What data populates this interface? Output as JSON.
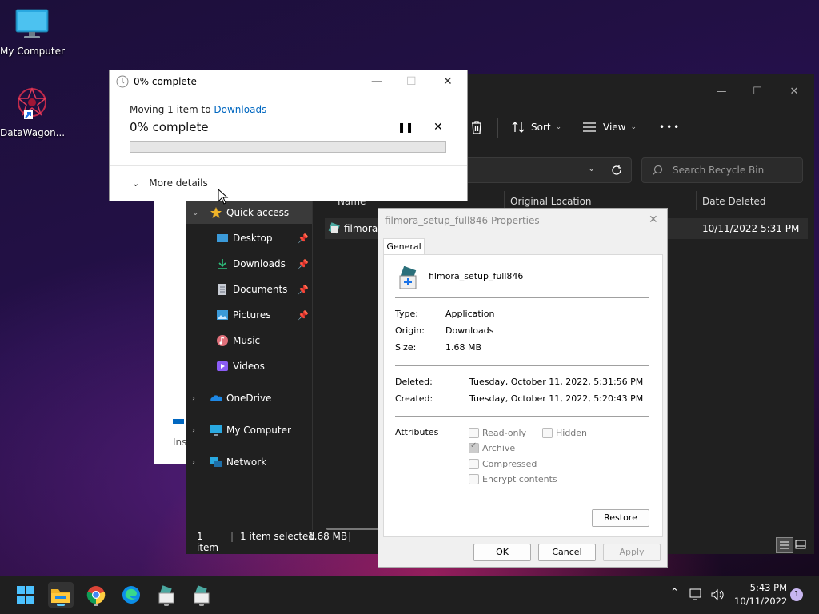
{
  "desktop": {
    "icons": [
      {
        "label": "My Computer"
      },
      {
        "label": "DataWagon..."
      }
    ]
  },
  "background_window": {
    "partial_text": "Ins"
  },
  "explorer": {
    "toolbar": {
      "sort_label": "Sort",
      "view_label": "View",
      "more": "•••"
    },
    "search_placeholder": "Search Recycle Bin",
    "columns": {
      "name": "Name",
      "original_location": "Original Location",
      "date_deleted": "Date Deleted"
    },
    "file_row": {
      "name": "filmora_",
      "date_deleted": "10/11/2022 5:31 PM"
    },
    "nav": [
      {
        "label": "Quick access",
        "icon": "star-icon",
        "selected": true
      },
      {
        "label": "Desktop",
        "icon": "desktop-folder-icon",
        "pinned": true
      },
      {
        "label": "Downloads",
        "icon": "downloads-folder-icon",
        "pinned": true
      },
      {
        "label": "Documents",
        "icon": "documents-folder-icon",
        "pinned": true
      },
      {
        "label": "Pictures",
        "icon": "pictures-folder-icon",
        "pinned": true
      },
      {
        "label": "Music",
        "icon": "music-folder-icon"
      },
      {
        "label": "Videos",
        "icon": "videos-folder-icon"
      },
      {
        "label": "OneDrive",
        "icon": "onedrive-icon"
      },
      {
        "label": "My Computer",
        "icon": "computer-icon"
      },
      {
        "label": "Network",
        "icon": "network-icon"
      }
    ],
    "status": {
      "items": "1 item",
      "selected": "1 item selected",
      "size": "1.68 MB"
    }
  },
  "copy_dialog": {
    "title": "0% complete",
    "moving_prefix": "Moving 1 item to ",
    "destination": "Downloads",
    "progress_label": "0% complete",
    "progress": 0,
    "more_details": "More details",
    "accent": "#0067c0"
  },
  "properties": {
    "title": "filmora_setup_full846 Properties",
    "tab": "General",
    "file_name": "filmora_setup_full846",
    "type_label": "Type:",
    "type_value": "Application",
    "origin_label": "Origin:",
    "origin_value": "Downloads",
    "size_label": "Size:",
    "size_value": "1.68 MB",
    "deleted_label": "Deleted:",
    "deleted_value": "Tuesday, October 11, 2022, 5:31:56 PM",
    "created_label": "Created:",
    "created_value": "Tuesday, October 11, 2022, 5:20:43 PM",
    "attributes_label": "Attributes",
    "attributes": {
      "read_only": {
        "label": "Read-only",
        "checked": false
      },
      "hidden": {
        "label": "Hidden",
        "checked": false
      },
      "archive": {
        "label": "Archive",
        "checked": true
      },
      "compressed": {
        "label": "Compressed",
        "checked": false
      },
      "encrypt": {
        "label": "Encrypt contents",
        "checked": false
      }
    },
    "restore": "Restore",
    "ok": "OK",
    "cancel": "Cancel",
    "apply": "Apply"
  },
  "taskbar": {
    "time": "5:43 PM",
    "date": "10/11/2022",
    "notifications": "1",
    "apps": [
      "start-icon",
      "file-explorer-icon",
      "chrome-icon",
      "edge-icon",
      "installer-icon",
      "installer-icon"
    ]
  }
}
